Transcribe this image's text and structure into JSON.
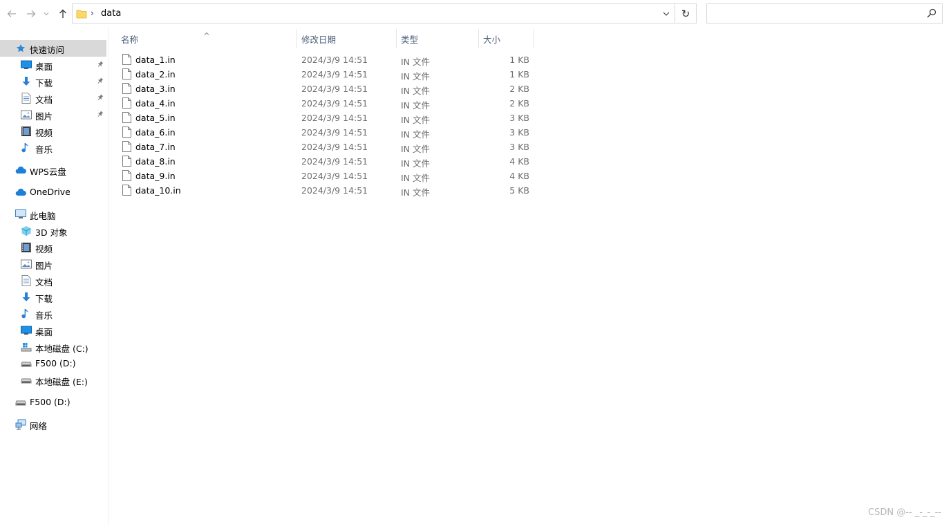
{
  "address": {
    "separator": "›",
    "current_folder": "data",
    "refresh_glyph": "↻"
  },
  "search": {
    "placeholder": ""
  },
  "sidebar": {
    "items": [
      {
        "label": "快速访问",
        "icon": "star-icon",
        "pinned": false,
        "selected": true
      },
      {
        "label": "桌面",
        "icon": "desktop-icon",
        "pinned": true
      },
      {
        "label": "下载",
        "icon": "download-icon",
        "pinned": true
      },
      {
        "label": "文档",
        "icon": "document-icon",
        "pinned": true
      },
      {
        "label": "图片",
        "icon": "picture-icon",
        "pinned": true
      },
      {
        "label": "视频",
        "icon": "video-icon",
        "pinned": false
      },
      {
        "label": "音乐",
        "icon": "music-icon",
        "pinned": false
      },
      {
        "label": "WPS云盘",
        "icon": "cloud-icon",
        "pinned": false
      },
      {
        "label": "OneDrive",
        "icon": "cloud-icon",
        "pinned": false
      },
      {
        "label": "此电脑",
        "icon": "computer-icon",
        "pinned": false
      },
      {
        "label": "3D 对象",
        "icon": "cube-icon",
        "pinned": false
      },
      {
        "label": "视频",
        "icon": "video-icon",
        "pinned": false
      },
      {
        "label": "图片",
        "icon": "picture-icon",
        "pinned": false
      },
      {
        "label": "文档",
        "icon": "document-icon",
        "pinned": false
      },
      {
        "label": "下载",
        "icon": "download-icon",
        "pinned": false
      },
      {
        "label": "音乐",
        "icon": "music-icon",
        "pinned": false
      },
      {
        "label": "桌面",
        "icon": "desktop-icon",
        "pinned": false
      },
      {
        "label": "本地磁盘 (C:)",
        "icon": "windows-drive-icon",
        "pinned": false
      },
      {
        "label": "F500 (D:)",
        "icon": "drive-icon",
        "pinned": false
      },
      {
        "label": "本地磁盘 (E:)",
        "icon": "drive-icon",
        "pinned": false
      },
      {
        "label": "F500 (D:)",
        "icon": "drive-icon",
        "pinned": false
      },
      {
        "label": "网络",
        "icon": "network-icon",
        "pinned": false
      }
    ]
  },
  "columns": {
    "name": "名称",
    "date": "修改日期",
    "type": "类型",
    "size": "大小"
  },
  "files": [
    {
      "name": "data_1.in",
      "date": "2024/3/9 14:51",
      "type": "IN 文件",
      "size": "1 KB"
    },
    {
      "name": "data_2.in",
      "date": "2024/3/9 14:51",
      "type": "IN 文件",
      "size": "1 KB"
    },
    {
      "name": "data_3.in",
      "date": "2024/3/9 14:51",
      "type": "IN 文件",
      "size": "2 KB"
    },
    {
      "name": "data_4.in",
      "date": "2024/3/9 14:51",
      "type": "IN 文件",
      "size": "2 KB"
    },
    {
      "name": "data_5.in",
      "date": "2024/3/9 14:51",
      "type": "IN 文件",
      "size": "3 KB"
    },
    {
      "name": "data_6.in",
      "date": "2024/3/9 14:51",
      "type": "IN 文件",
      "size": "3 KB"
    },
    {
      "name": "data_7.in",
      "date": "2024/3/9 14:51",
      "type": "IN 文件",
      "size": "3 KB"
    },
    {
      "name": "data_8.in",
      "date": "2024/3/9 14:51",
      "type": "IN 文件",
      "size": "4 KB"
    },
    {
      "name": "data_9.in",
      "date": "2024/3/9 14:51",
      "type": "IN 文件",
      "size": "4 KB"
    },
    {
      "name": "data_10.in",
      "date": "2024/3/9 14:51",
      "type": "IN 文件",
      "size": "5 KB"
    }
  ],
  "watermark": "CSDN @-- _-_-_--",
  "colors": {
    "selected_bg": "#d9d9d9",
    "header_text": "#4c607a",
    "secondary_text": "#6d6d6d",
    "folder_yellow": "#ffd766",
    "accent_blue": "#1e90e6"
  }
}
